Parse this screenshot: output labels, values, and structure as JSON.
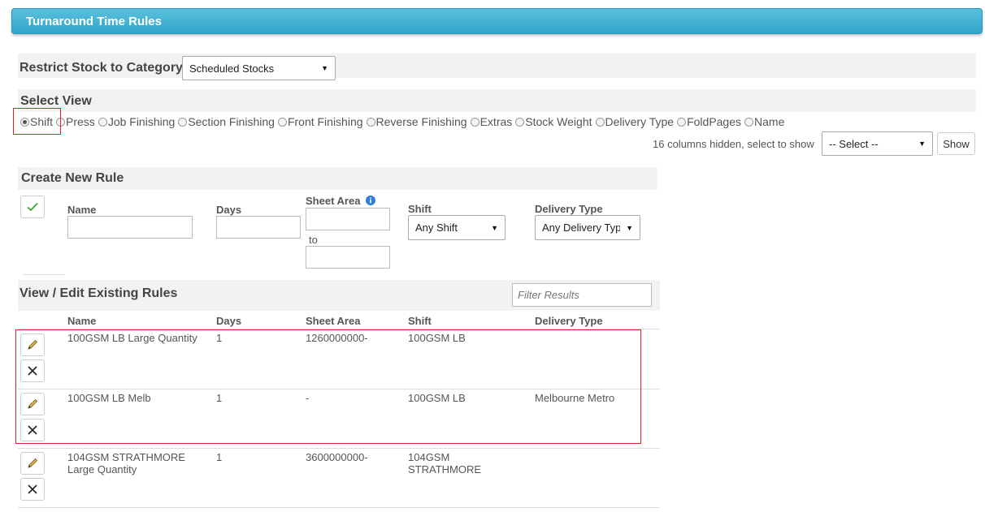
{
  "header": {
    "title": "Turnaround Time Rules"
  },
  "restrict": {
    "label": "Restrict Stock to Category",
    "selected": "Scheduled Stocks"
  },
  "select_view": {
    "label": "Select View",
    "options": [
      "Shift",
      "Press",
      "Job Finishing",
      "Section Finishing",
      "Front Finishing",
      "Reverse Finishing",
      "Extras",
      "Stock Weight",
      "Delivery Type",
      "FoldPages",
      "Name"
    ],
    "selected": "Shift"
  },
  "columns_hidden": {
    "text": "16 columns hidden, select to show",
    "select": "-- Select --",
    "show_button": "Show"
  },
  "create": {
    "title": "Create New Rule",
    "name_label": "Name",
    "days_label": "Days",
    "sheet_area_label": "Sheet Area",
    "to_label": "to",
    "shift_label": "Shift",
    "shift_value": "Any Shift",
    "delivery_label": "Delivery Type",
    "delivery_value": "Any Delivery Typ"
  },
  "existing": {
    "title": "View / Edit Existing Rules",
    "filter_placeholder": "Filter Results",
    "headers": {
      "name": "Name",
      "days": "Days",
      "sheet_area": "Sheet Area",
      "shift": "Shift",
      "delivery": "Delivery Type"
    },
    "rows": [
      {
        "name": "100GSM LB Large Quantity",
        "days": "1",
        "sheet_area": "1260000000-",
        "shift": "100GSM LB",
        "delivery": ""
      },
      {
        "name": "100GSM LB Melb",
        "days": "1",
        "sheet_area": "-",
        "shift": "100GSM LB",
        "delivery": "Melbourne Metro"
      },
      {
        "name": "104GSM STRATHMORE Large Quantity",
        "days": "1",
        "sheet_area": "3600000000-",
        "shift": "104GSM STRATHMORE",
        "delivery": ""
      }
    ]
  },
  "colors": {
    "header_blue": "#31a6c9",
    "highlight_red": "#d9232d",
    "check_green": "#3aa63a",
    "band_gray": "#f2f2f2"
  },
  "icons": {
    "edit": "pencil-icon",
    "delete": "close-icon",
    "confirm": "checkmark-icon",
    "info": "info-icon"
  }
}
